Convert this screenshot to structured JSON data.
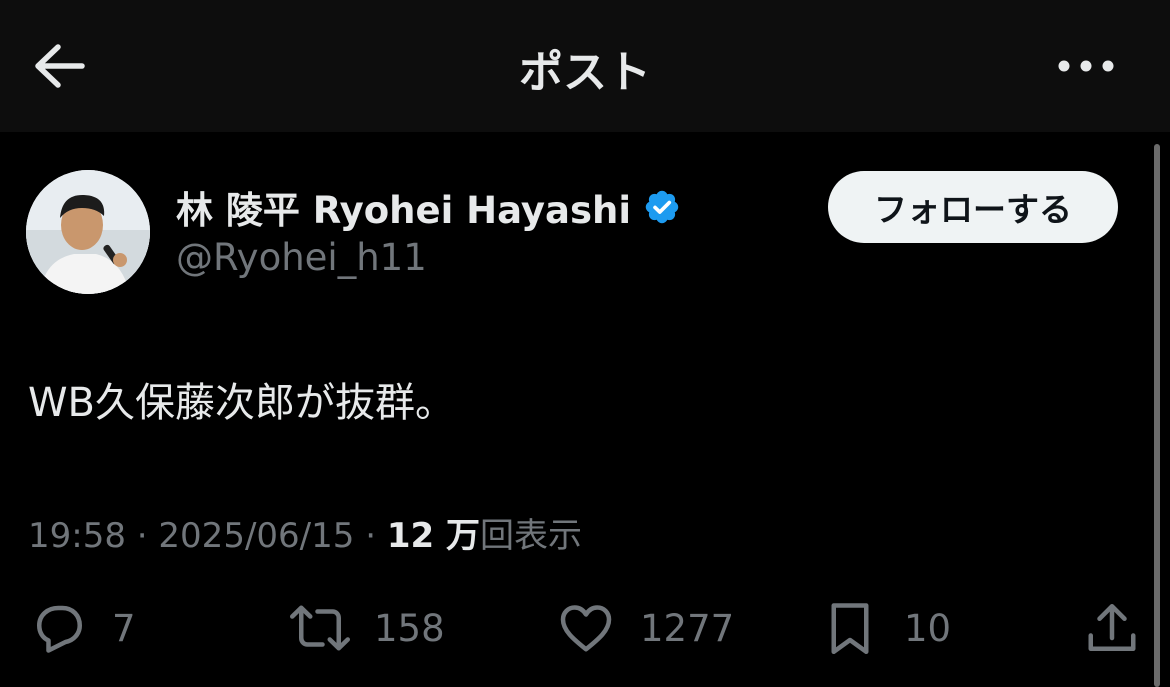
{
  "header": {
    "title": "ポスト"
  },
  "author": {
    "display_name": "林 陵平 Ryohei Hayashi",
    "handle": "@Ryohei_h11",
    "verified": true
  },
  "follow_label": "フォローする",
  "tweet": {
    "text": "WB久保藤次郎が抜群。"
  },
  "meta": {
    "time": "19:58",
    "separator": " · ",
    "date": "2025/06/15",
    "views_count": "12 万",
    "views_label": "回表示"
  },
  "actions": {
    "replies": "7",
    "reposts": "158",
    "likes": "1277",
    "bookmarks": "10"
  },
  "colors": {
    "background": "#000000",
    "header": "#0d0d0d",
    "primary_text": "#e7e9ea",
    "secondary_text": "#71767b",
    "verified": "#1d9bf0",
    "follow_bg": "#eff3f4"
  },
  "icons": [
    "back-arrow-icon",
    "more-icon",
    "verified-badge-icon",
    "reply-icon",
    "repost-icon",
    "like-icon",
    "bookmark-icon",
    "share-icon"
  ]
}
